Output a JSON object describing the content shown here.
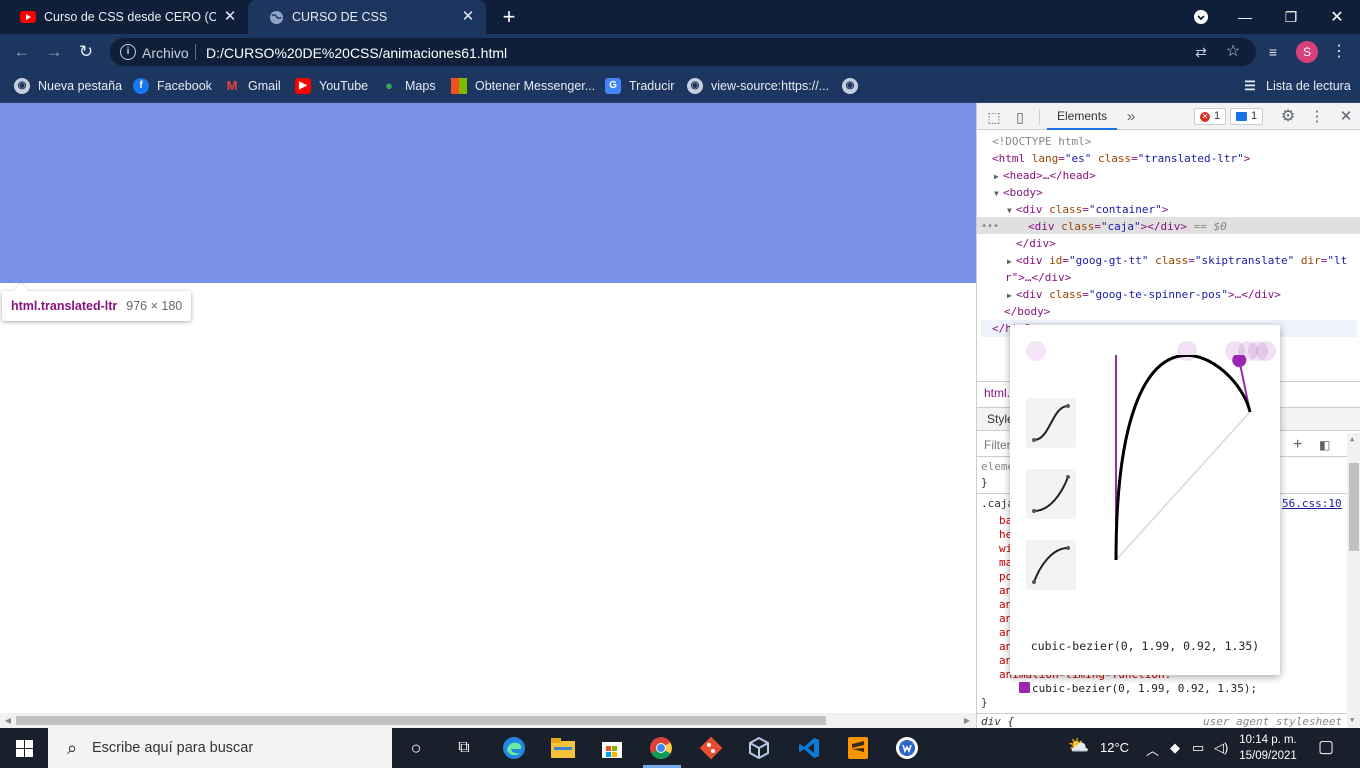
{
  "browser": {
    "tabs": [
      {
        "title": "Curso de CSS desde CERO (Comp",
        "favicon": "youtube-icon",
        "active": false
      },
      {
        "title": "CURSO DE CSS",
        "favicon": "globe-icon",
        "active": true
      }
    ],
    "new_tab": "+",
    "url_scheme": "Archivo",
    "url": "D:/CURSO%20DE%20CSS/animaciones61.html",
    "profile_initial": "S",
    "reading_list": "Lista de lectura",
    "bookmarks": [
      {
        "label": "Nueva pestaña",
        "icon": "globe-icon",
        "color": "#c6cfdf"
      },
      {
        "label": "Facebook",
        "icon": "facebook-icon",
        "color": "#1877f2"
      },
      {
        "label": "Gmail",
        "icon": "gmail-icon",
        "color": "#ea4335"
      },
      {
        "label": "YouTube",
        "icon": "youtube-icon",
        "color": "#ff0000"
      },
      {
        "label": "Maps",
        "icon": "maps-pin-icon",
        "color": "#34a853"
      },
      {
        "label": "Obtener Messenger...",
        "icon": "microsoft-icon",
        "color": "#f25022"
      },
      {
        "label": "Traducir",
        "icon": "translate-icon",
        "color": "#4285f4"
      },
      {
        "label": "view-source:https://...",
        "icon": "globe-icon",
        "color": "#c6cfdf"
      },
      {
        "label": "",
        "icon": "globe-icon",
        "color": "#c6cfdf"
      }
    ]
  },
  "page": {
    "box_color": "#7990e6",
    "tooltip": {
      "selector": "html.translated-ltr",
      "dimensions": "976 × 180"
    }
  },
  "devtools": {
    "tab_elements": "Elements",
    "more_tabs": "»",
    "errors": "1",
    "messages": "1",
    "dom": {
      "doctype": "<!DOCTYPE html>",
      "html_open_tag": "<html",
      "html_attrs": [
        {
          "name": "lang",
          "value": "\"es\""
        },
        {
          "name": "class",
          "value": "\"translated-ltr\""
        }
      ],
      "head": "<head>…</head>",
      "body_open": "<body>",
      "div_container": "<div",
      "container_attr": "class",
      "container_val": "\"container\"",
      "div_caja": "<div",
      "caja_attr": "class",
      "caja_val": "\"caja\"",
      "caja_close": "></div>",
      "eq_dollar": "== $0",
      "div_close": "</div>",
      "goog_div": "<div",
      "goog_id_attr": "id",
      "goog_id_val": "\"goog-gt-tt\"",
      "goog_class_attr": "class",
      "goog_class_val": "\"skiptranslate\"",
      "goog_dir_attr": "dir",
      "goog_dir_val": "\"lt",
      "goog_wrap": "r\">…</div>",
      "spinner_div": "<div",
      "spinner_attr": "class",
      "spinner_val": "\"goog-te-spinner-pos\"",
      "spinner_rest": ">…</div>",
      "body_close": "</body>",
      "html_close": "</html>"
    },
    "breadcrumb": "html.",
    "styles_tab": "Styles",
    "filter_placeholder": "Filter",
    "styles": {
      "element_rule": "element.style {",
      "close_brace": "}",
      "selector": ".caja {",
      "source": "56.css:10",
      "props": [
        "ba",
        "he",
        "wi",
        "ma",
        "po",
        "an",
        "an",
        "an",
        "an",
        "an",
        "an"
      ],
      "timing_prop": "animation-timing-function:",
      "timing_value": "cubic-bezier(0, 1.99, 0.92, 1.35);",
      "div_rule": "div {",
      "ua": "user agent stylesheet"
    },
    "bezier": {
      "x1": 0,
      "y1": 1.99,
      "x2": 0.92,
      "y2": 1.35,
      "label": "cubic-bezier(0, 1.99, 0.92, 1.35)",
      "curve_color": "#000000",
      "handle_color": "#9c27b0",
      "presets": [
        "ease-in-out-preset-icon",
        "ease-in-preset-icon",
        "ease-out-preset-icon"
      ]
    }
  },
  "taskbar": {
    "search_placeholder": "Escribe aquí para buscar",
    "weather": "12°C",
    "time": "10:14 p. m.",
    "date": "15/09/2021"
  }
}
